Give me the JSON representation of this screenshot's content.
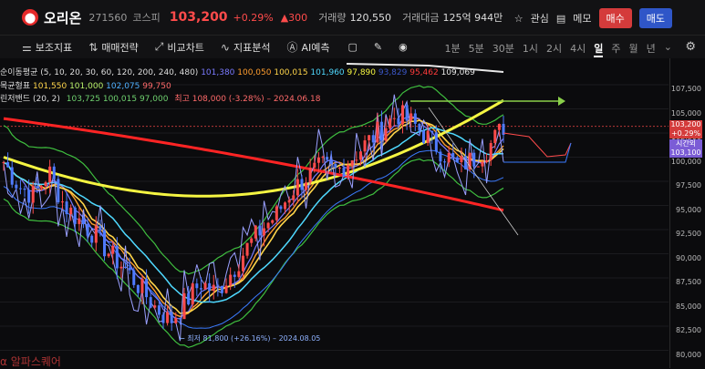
{
  "header": {
    "logo": "⬤",
    "name": "오리온",
    "code": "271560",
    "market": "코스피",
    "price": "103,200",
    "change_pct": "+0.29%",
    "change_abs": "▲300",
    "volume_label": "거래량",
    "volume": "120,550",
    "turnover_label": "거래대금",
    "turnover": "125억 944만",
    "interest": "관심",
    "memo": "메모",
    "buy": "매수",
    "sell": "매도"
  },
  "toolbar": {
    "items": [
      {
        "label": "보조지표",
        "icon": "sliders-icon"
      },
      {
        "label": "매매전략",
        "icon": "strategy-icon"
      },
      {
        "label": "비교차트",
        "icon": "compare-icon"
      },
      {
        "label": "지표분석",
        "icon": "analysis-icon"
      },
      {
        "label": "AI예측",
        "icon": "ai-icon"
      }
    ],
    "periods": [
      "1분",
      "5분",
      "30분",
      "1시",
      "2시",
      "4시",
      "일",
      "주",
      "월",
      "년"
    ],
    "active_period": "일"
  },
  "legend": {
    "ma_title": "순이동평균 (5, 10, 20, 30, 60, 120, 200, 240, 480)",
    "ma_values": [
      {
        "v": "101,380",
        "c": "#7a7aff"
      },
      {
        "v": "100,050",
        "c": "#ff9d2e"
      },
      {
        "v": "100,015",
        "c": "#ffd54a"
      },
      {
        "v": "101,960",
        "c": "#4fd9ff"
      },
      {
        "v": "97,890",
        "c": "#f5f542"
      },
      {
        "v": "93,829",
        "c": "#3b57c7"
      },
      {
        "v": "95,462",
        "c": "#ff3b3b"
      },
      {
        "v": "109,069",
        "c": "#e8e8e8"
      }
    ],
    "ichi_title": "목균형표",
    "ichi_values": [
      {
        "v": "101,550",
        "c": "#ffd54a"
      },
      {
        "v": "101,000",
        "c": "#b8f06a"
      },
      {
        "v": "102,075",
        "c": "#4fb0ff"
      },
      {
        "v": "99,750",
        "c": "#ff6a6a"
      }
    ],
    "bb_title": "린저밴드 (20, 2)",
    "bb_values": "103,725  100,015  97,000",
    "high_annot": "최고 108,000 (-3.28%) – 2024.06.18"
  },
  "axis": {
    "ticks": [
      "107,500",
      "105,000",
      "102,500",
      "100,000",
      "97,500",
      "95,000",
      "92,500",
      "90,000",
      "87,500",
      "85,000",
      "82,500",
      "80,000"
    ]
  },
  "price_tags": {
    "current": "103,200",
    "current_pct": "+0.29%",
    "after_label": "시간외",
    "after": "103,100"
  },
  "low_annot": "← 최저 81,800 (+26.16%) – 2024.08.05",
  "watermark": "알파스퀘어",
  "colors": {
    "up": "#ff4b4b",
    "down": "#4f7bff",
    "bb": "#3fbf3f",
    "ma120": "#ff2424",
    "ma60": "#f5f542",
    "ma30": "#4fd9ff",
    "hl": "#9aa0ff"
  }
}
